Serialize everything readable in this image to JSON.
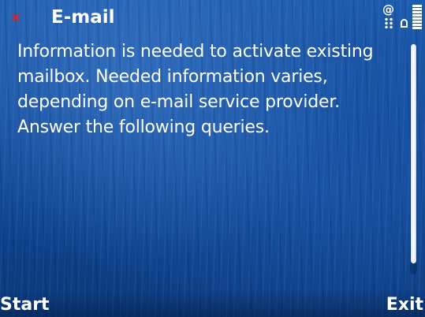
{
  "header": {
    "close_glyph": "×",
    "title": "E-mail",
    "status_icons": [
      "email-indicator-icon",
      "lock-icon",
      "battery-icon"
    ]
  },
  "body": {
    "message": "Information is needed to activate existing mailbox. Needed information varies, depending on e-mail service provider. Answer the following queries."
  },
  "softkeys": {
    "left": "Start",
    "right": "Exit"
  },
  "colors": {
    "close_red": "#e52222",
    "text": "#ffffff",
    "background_blue": "#154e9e"
  }
}
